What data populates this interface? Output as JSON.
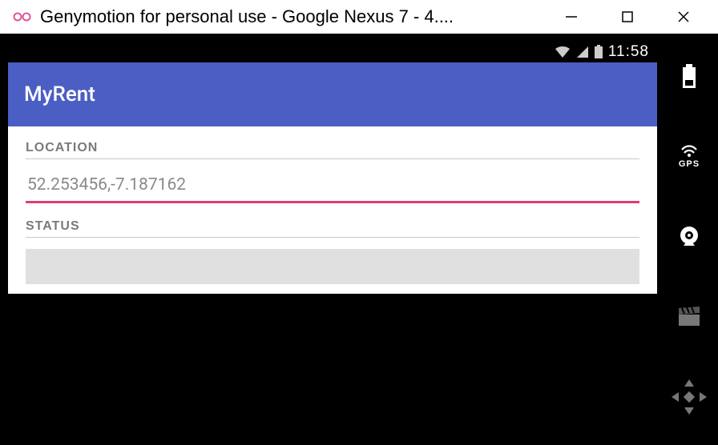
{
  "window": {
    "title": "Genymotion for personal use - Google Nexus 7 - 4...."
  },
  "android_status": {
    "time": "11:58"
  },
  "app": {
    "title": "MyRent",
    "location_label": "LOCATION",
    "location_value": "52.253456,-7.187162",
    "status_label": "STATUS"
  },
  "sidebar": {
    "gps_label": "GPS"
  },
  "colors": {
    "app_bar": "#4b5ec3",
    "accent": "#de3e73"
  }
}
